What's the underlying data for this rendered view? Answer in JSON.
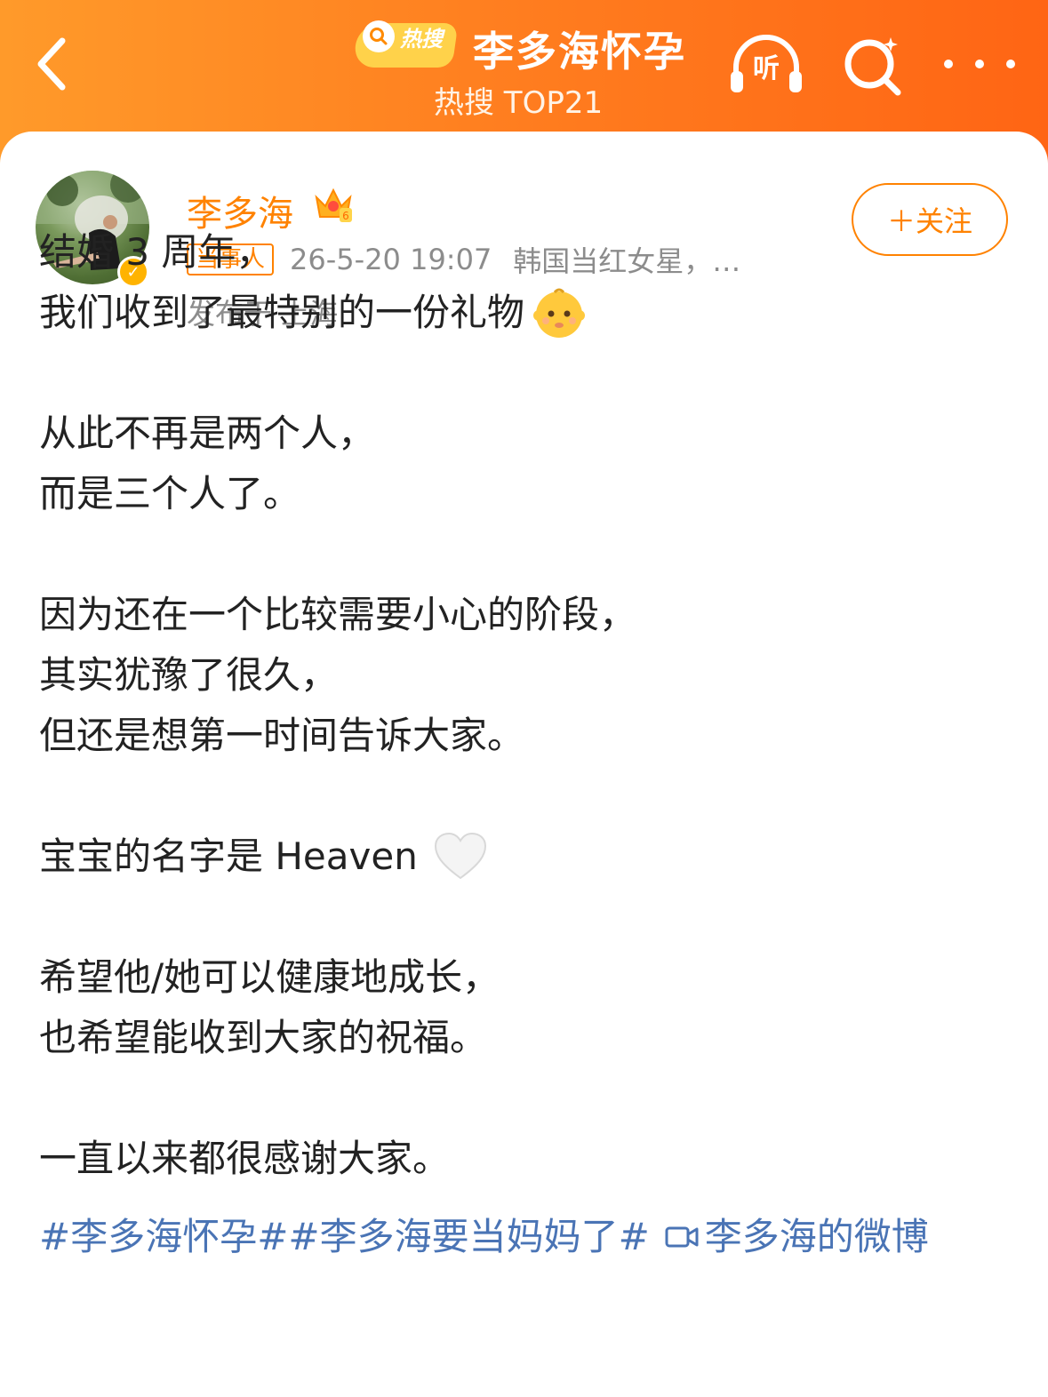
{
  "header": {
    "hot_label": "热搜",
    "topic_title": "李多海怀孕",
    "topic_rank": "热搜 TOP21",
    "listen_label": "听",
    "colors": {
      "start": "#ff9a2a",
      "end": "#ff6514"
    }
  },
  "post": {
    "author": "李多海",
    "role_badge": "当事人",
    "time": "26-5-20 19:07",
    "source": "韩国当红女星，…",
    "location": "发布于 上海",
    "follow_label": "＋关注",
    "lines": [
      "结婚 3 周年，",
      "我们收到了最特别的一份礼物",
      "从此不再是两个人，",
      "而是三个人了。",
      "因为还在一个比较需要小心的阶段，",
      "其实犹豫了很久，",
      "但还是想第一时间告诉大家。",
      "宝宝的名字是 Heaven",
      "希望他/她可以健康地成长，",
      "也希望能收到大家的祝福。",
      "一直以来都很感谢大家。"
    ],
    "hashtags": [
      "#李多海怀孕#",
      "#李多海要当妈妈了#"
    ],
    "source_link": "李多海的微博",
    "accent_color": "#ff8200",
    "link_color": "#4a74b5"
  },
  "icons": [
    "back-arrow-icon",
    "hot-search-icon",
    "headphones-icon",
    "search-icon",
    "more-dots-icon",
    "crown-icon",
    "verified-icon",
    "baby-emoji-icon",
    "white-heart-emoji-icon",
    "video-icon"
  ]
}
